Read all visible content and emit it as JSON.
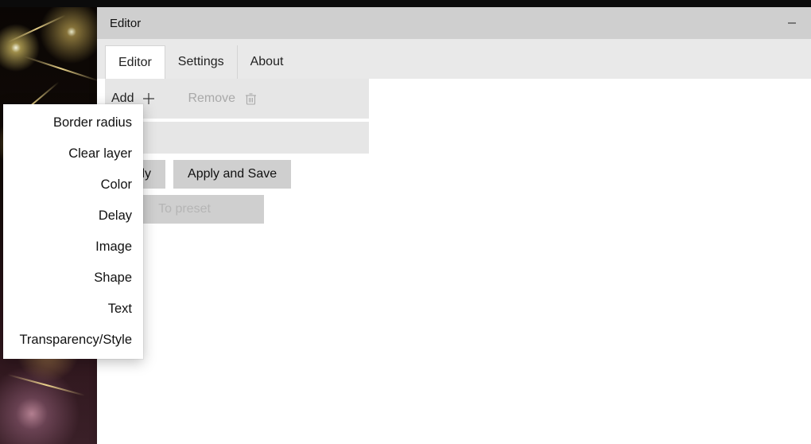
{
  "window": {
    "title": "Editor"
  },
  "tabs": {
    "editor": "Editor",
    "settings": "Settings",
    "about": "About"
  },
  "toolbar": {
    "add_label": "Add",
    "remove_label": "Remove"
  },
  "buttons": {
    "apply": "Apply",
    "apply_save": "Apply and Save",
    "to_preset": "To preset"
  },
  "add_menu": {
    "items": [
      "Border radius",
      "Clear layer",
      "Color",
      "Delay",
      "Image",
      "Shape",
      "Text",
      "Transparency/Style"
    ]
  }
}
